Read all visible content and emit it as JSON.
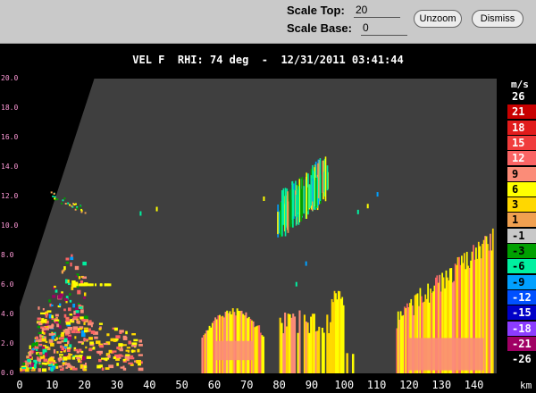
{
  "toolbar": {
    "scale_top_label": "Scale Top:",
    "scale_top_value": "20",
    "scale_base_label": "Scale Base:",
    "scale_base_value": "0",
    "unzoom_label": "Unzoom",
    "dismiss_label": "Dismiss"
  },
  "plot": {
    "title": "VEL F  RHI: 74 deg  -  12/31/2011 03:41:44",
    "x_unit": "km",
    "legend_unit": "m/s"
  },
  "colors": {
    "background": "#3f3f3f",
    "toolbar": "#c9c9c9"
  },
  "legend": [
    {
      "label": "26",
      "color": "#000000",
      "text": "#ffffff"
    },
    {
      "label": "21",
      "color": "#c80000",
      "text": "#ffffff"
    },
    {
      "label": "18",
      "color": "#e11b1b",
      "text": "#ffffff"
    },
    {
      "label": "15",
      "color": "#f03c3c",
      "text": "#ffffff"
    },
    {
      "label": "12",
      "color": "#fa6464",
      "text": "#ffffff"
    },
    {
      "label": "9",
      "color": "#fb8c78",
      "text": "#000000"
    },
    {
      "label": "6",
      "color": "#ffff00",
      "text": "#000000"
    },
    {
      "label": "3",
      "color": "#ffd700",
      "text": "#000000"
    },
    {
      "label": "1",
      "color": "#f0a050",
      "text": "#000000"
    },
    {
      "label": "-1",
      "color": "#c8c8c8",
      "text": "#000000"
    },
    {
      "label": "-3",
      "color": "#00a000",
      "text": "#000000"
    },
    {
      "label": "-6",
      "color": "#00f0a0",
      "text": "#000000"
    },
    {
      "label": "-9",
      "color": "#00a0ff",
      "text": "#000000"
    },
    {
      "label": "-12",
      "color": "#0050ff",
      "text": "#ffffff"
    },
    {
      "label": "-15",
      "color": "#0000c8",
      "text": "#ffffff"
    },
    {
      "label": "-18",
      "color": "#8c3cff",
      "text": "#ffffff"
    },
    {
      "label": "-21",
      "color": "#a00064",
      "text": "#ffffff"
    },
    {
      "label": "-26",
      "color": "#000000",
      "text": "#ffffff"
    }
  ],
  "chart_data": {
    "type": "heatmap",
    "title": "VEL F  RHI: 74 deg  -  12/31/2011 03:41:44",
    "xlabel": "km",
    "ylabel": "",
    "x_ticks": [
      "0",
      "10",
      "20",
      "30",
      "40",
      "50",
      "60",
      "70",
      "80",
      "90",
      "100",
      "110",
      "120",
      "130",
      "140"
    ],
    "y_ticks": [
      "20.0",
      "18.0",
      "16.0",
      "14.0",
      "12.0",
      "10.0",
      "8.0",
      "6.0",
      "4.0",
      "2.0",
      "0.0"
    ],
    "xlim": [
      0,
      147
    ],
    "ylim": [
      0,
      20
    ],
    "colorbar_unit": "m/s",
    "echo_regions": [
      {
        "x": [
          0,
          20
        ],
        "y": [
          0,
          7.5
        ],
        "values": "mixed"
      },
      {
        "x": [
          14,
          40
        ],
        "y": [
          0,
          4.8
        ],
        "values": "mixed"
      },
      {
        "x": [
          56,
          75
        ],
        "y": [
          0,
          4.5
        ],
        "values": [
          6,
          3,
          9
        ]
      },
      {
        "x": [
          80,
          100
        ],
        "y": [
          0,
          4.5
        ],
        "values": [
          6,
          3
        ]
      },
      {
        "x": [
          79,
          95
        ],
        "y": [
          9.3,
          13.5
        ],
        "values": [
          -6,
          -3,
          -9
        ]
      },
      {
        "x": [
          116,
          146
        ],
        "y": [
          0,
          9.5
        ],
        "values": [
          6,
          3,
          9,
          12
        ]
      }
    ]
  }
}
